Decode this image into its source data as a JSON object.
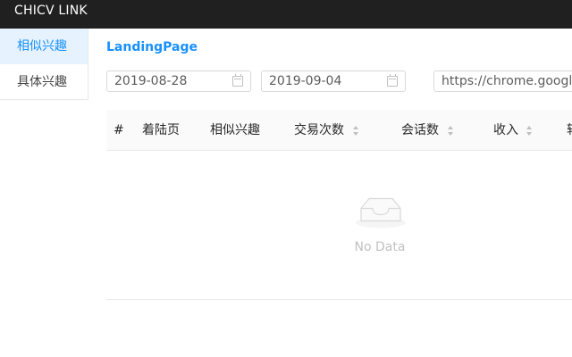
{
  "app": {
    "brand": "CHICV LINK"
  },
  "sidebar": {
    "items": [
      {
        "label": "相似兴趣",
        "active": true
      },
      {
        "label": "具体兴趣",
        "active": false
      }
    ]
  },
  "page": {
    "title": "LandingPage",
    "filters": {
      "start_date": "2019-08-28",
      "end_date": "2019-09-04",
      "url": "https://chrome.google.com/"
    }
  },
  "table": {
    "columns": [
      "#",
      "着陆页",
      "相似兴趣",
      "交易次数",
      "会话数",
      "收入",
      "转"
    ],
    "empty_text": "No Data"
  },
  "colors": {
    "topbar": "#202020",
    "accent": "#1890ff",
    "sidebar_active_bg": "#e6f3ff"
  },
  "icons": {
    "date_picker": "calendar-icon",
    "sortable_column": "sort-icon",
    "empty_state": "empty-inbox-icon"
  }
}
